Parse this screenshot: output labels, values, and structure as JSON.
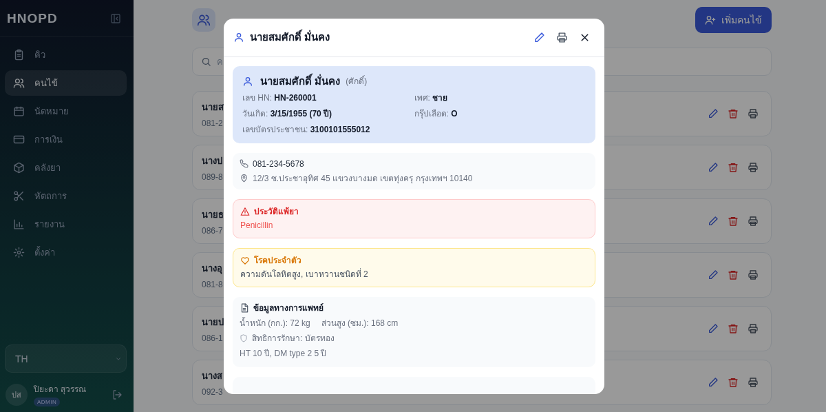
{
  "sidebar": {
    "brand": "HNOPD",
    "items": [
      {
        "label": "คิว",
        "selected": false
      },
      {
        "label": "คนไข้",
        "selected": true
      },
      {
        "label": "นัดหมาย",
        "selected": false
      },
      {
        "label": "การเงิน",
        "selected": false
      },
      {
        "label": "คลังยา",
        "selected": false
      },
      {
        "label": "หัตถการ",
        "selected": false
      },
      {
        "label": "รายงาน",
        "selected": false
      },
      {
        "label": "ตั้งค่า",
        "selected": false
      }
    ],
    "language": "TH",
    "user": {
      "initials": "ปส",
      "name": "ปิยะดา สุวรรณ",
      "role": "ADMIN"
    }
  },
  "main": {
    "add_button": "เพิ่มคนไข้",
    "search": {
      "placeholder": "ค"
    },
    "patients": [
      {
        "name": "นายส",
        "phone": "081-2"
      },
      {
        "name": "นางป",
        "phone": "089-8"
      },
      {
        "name": "นายธ",
        "phone": "086-7"
      },
      {
        "name": "นางอุ",
        "phone": "081-8"
      },
      {
        "name": "นายป",
        "phone": "086-1"
      },
      {
        "name": "นางส",
        "phone": "092-3"
      }
    ]
  },
  "modal": {
    "title": "นายสมศักดิ์ มั่นคง",
    "sections": [
      {
        "kind": "profile",
        "name": "นายสมศักดิ์ มั่นคง",
        "nickname": "(ศักดิ์)",
        "fields": [
          "เลข HN: **HN-260001**",
          "เพศ: **ชาย**",
          "วันเกิด: **3/15/1955 (70 ปี)**",
          "กรุ๊ปเลือด: **O**",
          "เลขบัตรประชาชน: **3100101555012**"
        ]
      },
      {
        "kind": "contact",
        "phone": "081-234-5678",
        "address": "12/3 ซ.ประชาอุทิศ 45 แขวงบางมด เขตทุ่งครุ กรุงเทพฯ 10140"
      },
      {
        "kind": "allergy",
        "title": "ประวัติแพ้ยา",
        "text": "Penicillin"
      },
      {
        "kind": "condition",
        "title": "โรคประจำตัว",
        "text": "ความดันโลหิตสูง, เบาหวานชนิดที่ 2"
      },
      {
        "kind": "medical",
        "title": "ข้อมูลทางการแพทย์",
        "measurements": [
          "น้ำหนัก (กก.): 72 kg",
          "ส่วนสูง (ซม.): 168 cm"
        ],
        "coverage": "สิทธิการรักษา: บัตรทอง",
        "note": "HT 10 ปี, DM type 2 5 ปี"
      },
      {
        "kind": "blank"
      }
    ]
  }
}
